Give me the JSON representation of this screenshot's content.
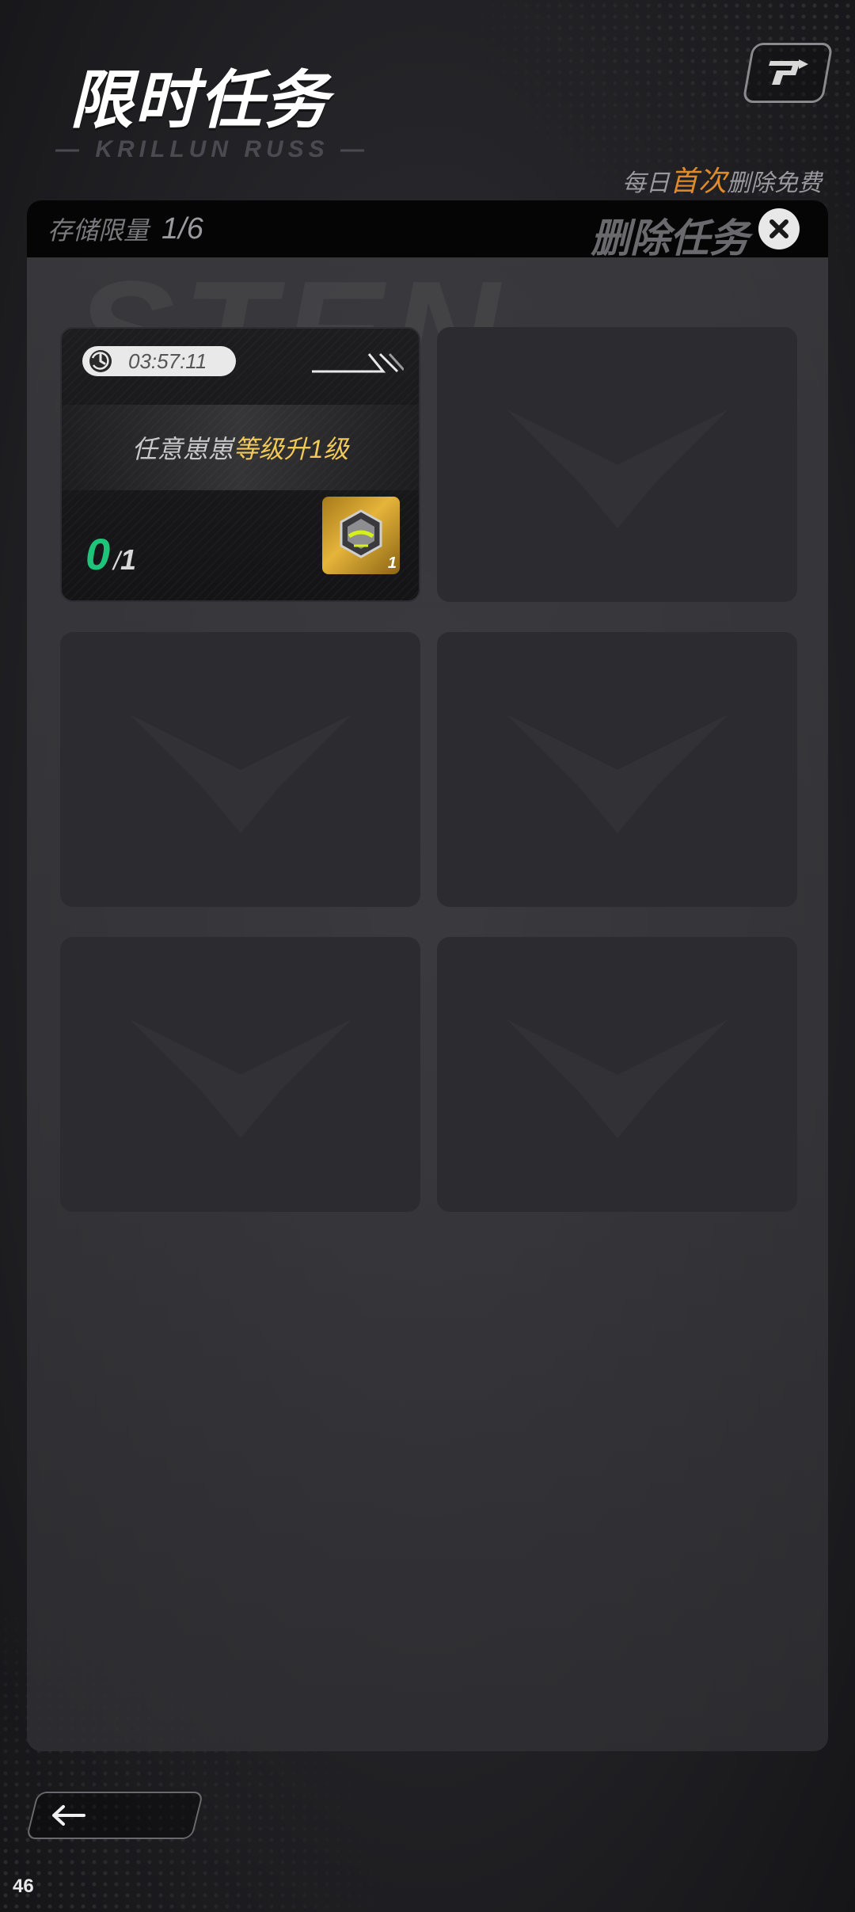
{
  "header": {
    "title": "限时任务",
    "subtitle_art": "— KRILLUN RUSS —",
    "corner_icon": "swap-arrow-icon"
  },
  "free_note": {
    "prefix": "每日",
    "highlight": "首次",
    "suffix": "删除免费",
    "highlight_color": "#e08a2a"
  },
  "panel": {
    "storage_label": "存储限量",
    "storage_value": "1/6",
    "delete_label": "删除任务",
    "close_icon": "close-icon"
  },
  "tasks": [
    {
      "timer": "03:57:11",
      "desc_plain": "任意崽崽",
      "desc_highlight": "等级升1级",
      "progress_current": "0",
      "progress_separator": "/",
      "progress_total": "1",
      "reward_icon": "helmet-reward-icon",
      "reward_count": "1"
    }
  ],
  "empty_slots": 5,
  "footer": {
    "back_icon": "back-arrow-icon",
    "corner_number": "46"
  },
  "colors": {
    "progress_green": "#1ec47a",
    "task_gold": "#f1c95a",
    "reward_gold": "#e5b43a"
  }
}
